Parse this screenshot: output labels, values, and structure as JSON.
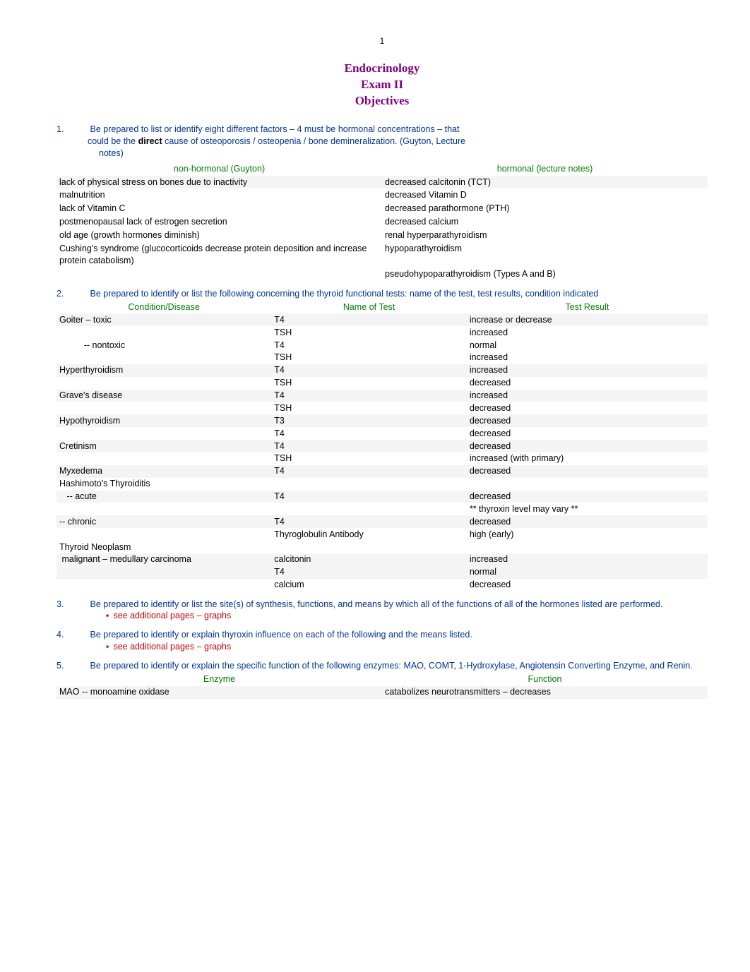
{
  "page_number": "1",
  "title": [
    "Endocrinology",
    "Exam II",
    "Objectives"
  ],
  "q1": {
    "num": "1.",
    "line1": "Be prepared to list or identify eight different factors – 4 must be hormonal concentrations – that",
    "line2_pre": "could be the ",
    "line2_direct": "direct",
    "line2_post": " cause of osteoporosis / osteopenia / bone demineralization.  (Guyton, Lecture",
    "line3": "notes)",
    "header_left": "non-hormonal (Guyton)",
    "header_right": "hormonal (lecture notes)",
    "rows": [
      {
        "l": "lack of physical stress on bones due to inactivity",
        "r": "decreased calcitonin (TCT)",
        "shade": true
      },
      {
        "l": "malnutrition",
        "r": "decreased Vitamin D",
        "shade": false
      },
      {
        "l": "lack of Vitamin C",
        "r": "decreased parathormone (PTH)",
        "shade": false
      },
      {
        "l": "postmenopausal lack of estrogen secretion",
        "r": "decreased calcium",
        "shade": false
      },
      {
        "l": "old age (growth hormones diminish)",
        "r": "renal hyperparathyroidism",
        "shade": false
      },
      {
        "l": "Cushing's syndrome (glucocorticoids decrease protein deposition and increase protein catabolism)",
        "r": "hypoparathyroidism",
        "shade": false
      },
      {
        "l": "",
        "r": "pseudohypoparathyroidism (Types A and B)",
        "shade": false
      }
    ]
  },
  "q2": {
    "num": "2.",
    "text": "Be prepared to identify or list the following concerning the thyroid functional tests:  name of the test, test results, condition indicated",
    "h1": "Condition/Disease",
    "h2": "Name of Test",
    "h3": "Test Result",
    "rows": [
      {
        "c1": "Goiter – toxic",
        "c2": "T4",
        "c3": "increase or decrease",
        "shade": true
      },
      {
        "c1": "",
        "c2": "TSH",
        "c3": "increased",
        "shade": false
      },
      {
        "c1": "          -- nontoxic",
        "c2": "T4",
        "c3": "normal",
        "shade": false
      },
      {
        "c1": "",
        "c2": "TSH",
        "c3": "increased",
        "shade": false
      },
      {
        "c1": "Hyperthyroidism",
        "c2": "T4",
        "c3": "increased",
        "shade": true
      },
      {
        "c1": "",
        "c2": "TSH",
        "c3": "decreased",
        "shade": false
      },
      {
        "c1": "Grave's disease",
        "c2": "T4",
        "c3": "increased",
        "shade": true
      },
      {
        "c1": "",
        "c2": "TSH",
        "c3": "decreased",
        "shade": false
      },
      {
        "c1": "Hypothyroidism",
        "c2": "T3",
        "c3": "decreased",
        "shade": true
      },
      {
        "c1": "",
        "c2": "T4",
        "c3": "decreased",
        "shade": false
      },
      {
        "c1": "Cretinism",
        "c2": "T4",
        "c3": "decreased",
        "shade": true
      },
      {
        "c1": "",
        "c2": "TSH",
        "c3": "increased (with primary)",
        "shade": false
      },
      {
        "c1": "Myxedema",
        "c2": "T4",
        "c3": "decreased",
        "shade": true
      },
      {
        "c1": "Hashimoto's Thyroiditis",
        "c2": "",
        "c3": "",
        "shade": false
      },
      {
        "c1": "   -- acute",
        "c2": "T4",
        "c3": "decreased",
        "shade": true
      },
      {
        "c1": "",
        "c2": "",
        "c3": "** thyroxin level may vary **",
        "shade": false
      },
      {
        "c1": "-- chronic",
        "c2": "T4",
        "c3": "decreased",
        "shade": true
      },
      {
        "c1": "",
        "c2": "Thyroglobulin Antibody",
        "c3": "high (early)",
        "shade": false
      },
      {
        "c1": "Thyroid Neoplasm",
        "c2": "",
        "c3": "",
        "shade": false
      },
      {
        "c1": " malignant – medullary carcinoma",
        "c2": "calcitonin",
        "c3": "increased",
        "shade": true
      },
      {
        "c1": "",
        "c2": "T4",
        "c3": "normal",
        "shade": true
      },
      {
        "c1": "",
        "c2": "calcium",
        "c3": "decreased",
        "shade": false
      }
    ]
  },
  "q3": {
    "num": "3.",
    "text": "Be prepared to identify or list the site(s) of synthesis, functions, and means by which all of the functions of all of the hormones listed are performed.",
    "bullet": "see additional pages – graphs"
  },
  "q4": {
    "num": "4.",
    "text": "Be prepared to identify or explain thyroxin influence on each of the following and the means listed.",
    "bullet": "see additional pages – graphs"
  },
  "q5": {
    "num": "5.",
    "text": "Be prepared to identify or explain the specific function of the following enzymes:  MAO, COMT, 1-Hydroxylase, Angiotensin Converting Enzyme, and Renin.",
    "h1": "Enzyme",
    "h2": "Function",
    "rows": [
      {
        "c1": "MAO  -- monoamine oxidase",
        "c2": "catabolizes neurotransmitters – decreases",
        "shade": true
      }
    ]
  }
}
